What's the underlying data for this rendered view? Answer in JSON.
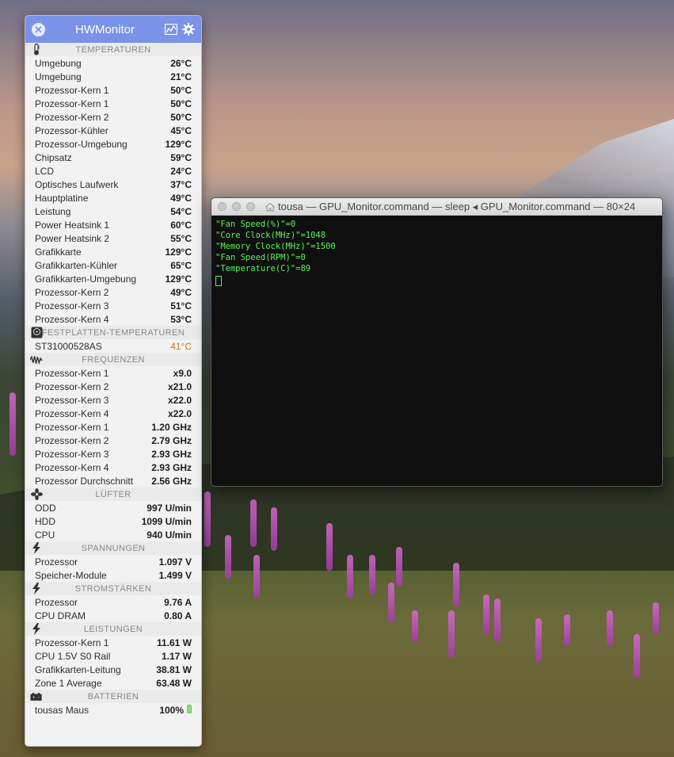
{
  "hwmonitor": {
    "title": "HWMonitor",
    "sections": [
      {
        "header": "TEMPERATUREN",
        "icon": "thermometer-icon",
        "rows": [
          {
            "label": "Umgebung",
            "value": "26°C"
          },
          {
            "label": "Umgebung",
            "value": "21°C"
          },
          {
            "label": "Prozessor-Kern 1",
            "value": "50°C"
          },
          {
            "label": "Prozessor-Kern 1",
            "value": "50°C"
          },
          {
            "label": "Prozessor-Kern 2",
            "value": "50°C"
          },
          {
            "label": "Prozessor-Kühler",
            "value": "45°C"
          },
          {
            "label": "Prozessor-Umgebung",
            "value": "129°C"
          },
          {
            "label": "Chipsatz",
            "value": "59°C"
          },
          {
            "label": "LCD",
            "value": "24°C"
          },
          {
            "label": "Optisches Laufwerk",
            "value": "37°C"
          },
          {
            "label": "Hauptplatine",
            "value": "49°C"
          },
          {
            "label": "Leistung",
            "value": "54°C"
          },
          {
            "label": "Power Heatsink 1",
            "value": "60°C"
          },
          {
            "label": "Power Heatsink 2",
            "value": "55°C"
          },
          {
            "label": "Grafikkarte",
            "value": "129°C"
          },
          {
            "label": "Grafikkarten-Kühler",
            "value": "65°C"
          },
          {
            "label": "Grafikkarten-Umgebung",
            "value": "129°C"
          },
          {
            "label": "Prozessor-Kern 2",
            "value": "49°C"
          },
          {
            "label": "Prozessor-Kern 3",
            "value": "51°C"
          },
          {
            "label": "Prozessor-Kern 4",
            "value": "53°C"
          }
        ]
      },
      {
        "header": "FESTPLATTEN-TEMPERATUREN",
        "icon": "hard-disk-icon",
        "rows": [
          {
            "label": "ST31000528AS",
            "value": "41°C",
            "warn": true
          }
        ]
      },
      {
        "header": "FREQUENZEN",
        "icon": "waveform-icon",
        "rows": [
          {
            "label": "Prozessor-Kern 1",
            "value": "x9.0"
          },
          {
            "label": "Prozessor-Kern 2",
            "value": "x21.0"
          },
          {
            "label": "Prozessor-Kern 3",
            "value": "x22.0"
          },
          {
            "label": "Prozessor-Kern 4",
            "value": "x22.0"
          },
          {
            "label": "Prozessor-Kern 1",
            "value": "1.20 GHz"
          },
          {
            "label": "Prozessor-Kern 2",
            "value": "2.79 GHz"
          },
          {
            "label": "Prozessor-Kern 3",
            "value": "2.93 GHz"
          },
          {
            "label": "Prozessor-Kern 4",
            "value": "2.93 GHz"
          },
          {
            "label": "Prozessor Durchschnitt",
            "value": "2.56 GHz"
          }
        ]
      },
      {
        "header": "LÜFTER",
        "icon": "fan-icon",
        "rows": [
          {
            "label": "ODD",
            "value": "997 U/min"
          },
          {
            "label": "HDD",
            "value": "1099 U/min"
          },
          {
            "label": "CPU",
            "value": "940 U/min"
          }
        ]
      },
      {
        "header": "SPANNUNGEN",
        "icon": "lightning-icon",
        "rows": [
          {
            "label": "Prozessor",
            "value": "1.097 V"
          },
          {
            "label": "Speicher-Module",
            "value": "1.499 V"
          }
        ]
      },
      {
        "header": "STROMSTÄRKEN",
        "icon": "lightning-icon",
        "rows": [
          {
            "label": "Prozessor",
            "value": "9.76 A"
          },
          {
            "label": "CPU DRAM",
            "value": "0.80 A"
          }
        ]
      },
      {
        "header": "LEISTUNGEN",
        "icon": "lightning-icon",
        "rows": [
          {
            "label": "Prozessor-Kern 1",
            "value": "11.61 W"
          },
          {
            "label": "CPU 1.5V S0 Rail",
            "value": "1.17 W"
          },
          {
            "label": "Grafikkarten-Leitung",
            "value": "38.81 W"
          },
          {
            "label": "Zone 1 Average",
            "value": "63.48 W"
          }
        ]
      },
      {
        "header": "BATTERIEN",
        "icon": "battery-icon",
        "rows": [
          {
            "label": "tousas Maus",
            "value": "100%",
            "battery": true
          }
        ]
      }
    ]
  },
  "terminal": {
    "title": "tousa — GPU_Monitor.command — sleep ◂ GPU_Monitor.command — 80×24",
    "lines": [
      "\"Fan Speed(%)\"=0",
      "\"Core Clock(MHz)\"=1048",
      "\"Memory Clock(MHz)\"=1500",
      "\"Fan Speed(RPM)\"=0",
      "\"Temperature(C)\"=89"
    ]
  },
  "colors": {
    "titlebar": "#7a93e8",
    "terminal_text": "#5cf25c",
    "warn_value": "#d4751e"
  }
}
